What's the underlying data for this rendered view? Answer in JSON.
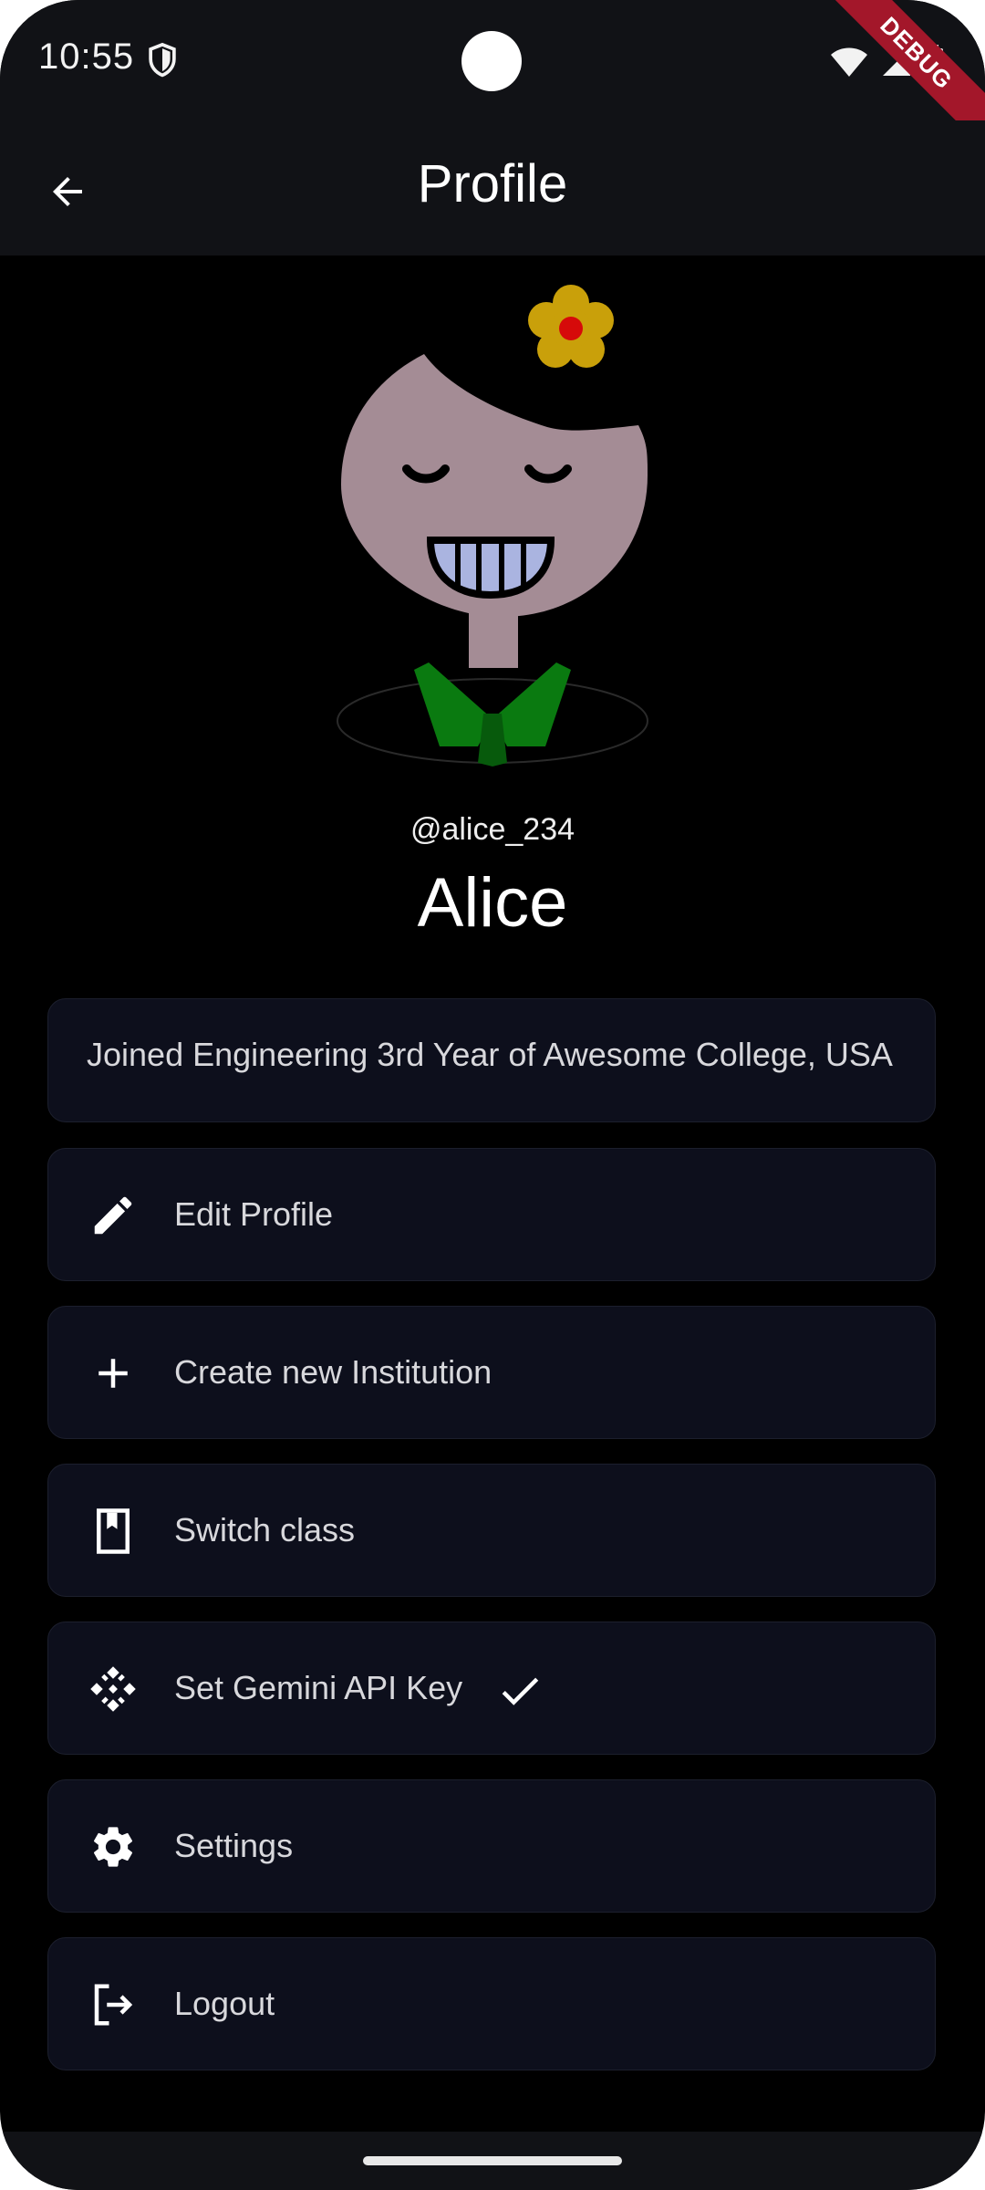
{
  "status_bar": {
    "time": "10:55",
    "shield_icon": "shield-icon",
    "wifi_icon": "wifi-icon",
    "signal_icon": "signal-icon",
    "battery_icon": "battery-icon",
    "debug_banner": "DEBUG"
  },
  "app_bar": {
    "back_icon": "arrow-back-icon",
    "title": "Profile"
  },
  "profile": {
    "avatar": "avatar-girl-with-flower",
    "username": "@alice_234",
    "name": "Alice",
    "bio": "Joined Engineering 3rd Year of Awesome College, USA"
  },
  "menu": [
    {
      "icon": "pencil-icon",
      "label": "Edit Profile"
    },
    {
      "icon": "plus-icon",
      "label": "Create new Institution"
    },
    {
      "icon": "book-icon",
      "label": "Switch class"
    },
    {
      "icon": "gemini-key-icon",
      "label": "Set Gemini API Key",
      "status_icon": "check-icon"
    },
    {
      "icon": "gear-icon",
      "label": "Settings"
    },
    {
      "icon": "logout-icon",
      "label": "Logout"
    }
  ],
  "colors": {
    "background": "#000000",
    "bar": "#111216",
    "card": "#0d0f1c",
    "text": "#d8d8dc",
    "accent_green": "#0a7a10",
    "flower_yellow": "#c9a00a",
    "debug_red": "#a3172a"
  }
}
